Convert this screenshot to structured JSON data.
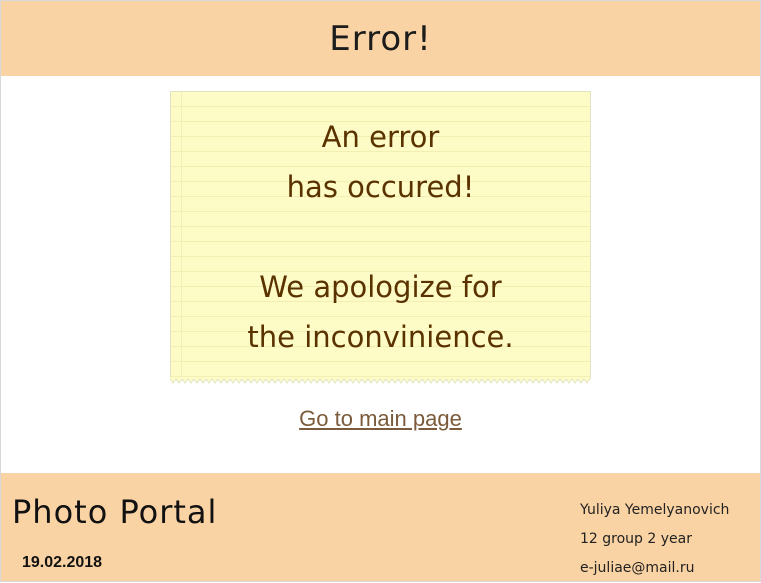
{
  "header": {
    "title": "Error!"
  },
  "note": {
    "lines_top": [
      "An error",
      "has occured!"
    ],
    "lines_bottom": [
      "We apologize for",
      "the inconvinience."
    ]
  },
  "main_link": {
    "label": "Go to main page"
  },
  "footer": {
    "brand": "Photo Portal",
    "date": "19.02.2018",
    "author_name": "Yuliya Yemelyanovich",
    "author_group": "12 group 2 year",
    "author_email": "e-juliae@mail.ru"
  },
  "colors": {
    "header_bg": "#fad3a4",
    "note_bg": "#fdfcc6",
    "note_text": "#5a3200",
    "link": "#7b5b3b"
  }
}
